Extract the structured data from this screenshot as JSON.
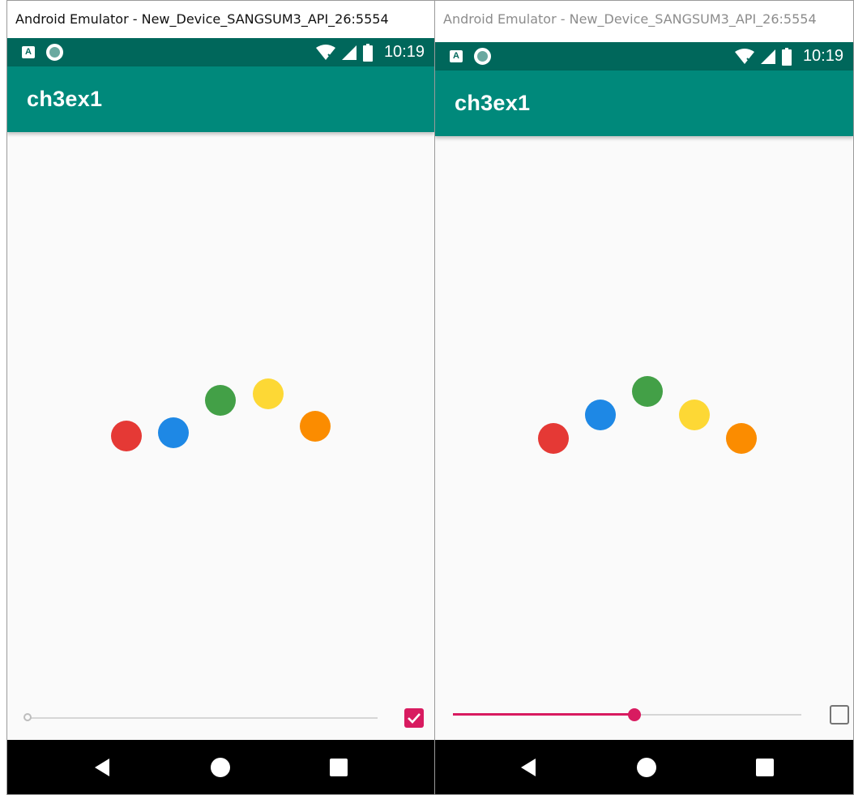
{
  "left": {
    "window_title": "Android Emulator - New_Device_SANGSUM3_API_26:5554",
    "status_time": "10:19",
    "app_title": "ch3ex1",
    "seekbar": {
      "progress_fraction": 0.0
    },
    "checkbox_checked": true
  },
  "right": {
    "window_title": "Android Emulator - New_Device_SANGSUM3_API_26:5554",
    "status_time": "10:19",
    "app_title": "ch3ex1",
    "seekbar": {
      "progress_fraction": 0.52
    },
    "checkbox_checked": false
  },
  "status_icons": [
    "android-notification-icon",
    "circle-notification-icon",
    "wifi-off-icon",
    "cell-signal-icon",
    "battery-icon"
  ],
  "nav_icons": [
    "back-icon",
    "home-icon",
    "recents-icon"
  ],
  "colors": {
    "status_bar": "#00675b",
    "app_bar": "#00897b",
    "accent": "#d81b60",
    "dot_red": "#e53935",
    "dot_blue": "#1e88e5",
    "dot_green": "#43a047",
    "dot_yellow": "#fdd835",
    "dot_orange": "#fb8c00"
  }
}
